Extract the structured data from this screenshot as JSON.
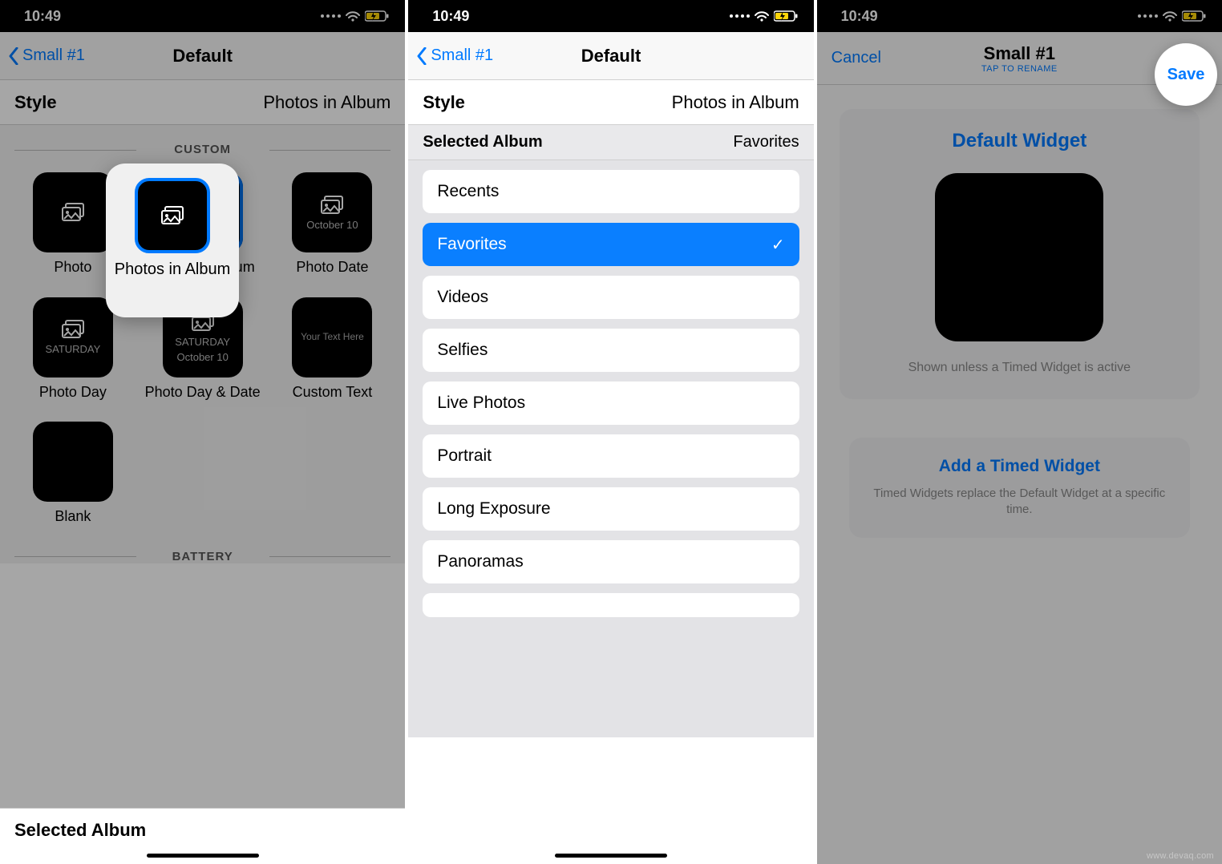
{
  "status": {
    "time": "10:49"
  },
  "colors": {
    "accent": "#007aff"
  },
  "phone1": {
    "back_label": "Small #1",
    "title": "Default",
    "style_label": "Style",
    "style_value": "Photos in Album",
    "section_custom": "CUSTOM",
    "section_battery": "BATTERY",
    "tiles": [
      {
        "key": "photo",
        "label": "Photo",
        "preview": "photos-icon"
      },
      {
        "key": "photos-in-album",
        "label": "Photos in Album",
        "preview": "photos-icon",
        "selected": true
      },
      {
        "key": "photo-date",
        "label": "Photo Date",
        "preview": "photos-icon",
        "preview_text": "October 10"
      },
      {
        "key": "photo-day",
        "label": "Photo Day",
        "preview": "photos-icon",
        "preview_text": "SATURDAY"
      },
      {
        "key": "photo-day-date",
        "label": "Photo Day & Date",
        "preview": "photos-icon",
        "preview_text": "SATURDAY",
        "preview_text2": "October 10"
      },
      {
        "key": "custom-text",
        "label": "Custom Text",
        "preview_text2_only": "Your Text Here"
      },
      {
        "key": "blank",
        "label": "Blank"
      }
    ],
    "sheet_label": "Selected Album"
  },
  "phone2": {
    "back_label": "Small #1",
    "title": "Default",
    "style_label": "Style",
    "style_value": "Photos in Album",
    "selected_album_label": "Selected Album",
    "selected_album_value": "Favorites",
    "albums": [
      {
        "name": "Recents",
        "selected": false
      },
      {
        "name": "Favorites",
        "selected": true
      },
      {
        "name": "Videos",
        "selected": false
      },
      {
        "name": "Selfies",
        "selected": false
      },
      {
        "name": "Live Photos",
        "selected": false
      },
      {
        "name": "Portrait",
        "selected": false
      },
      {
        "name": "Long Exposure",
        "selected": false
      },
      {
        "name": "Panoramas",
        "selected": false
      }
    ]
  },
  "phone3": {
    "cancel": "Cancel",
    "title": "Small #1",
    "subtitle": "TAP TO RENAME",
    "save": "Save",
    "widget_title": "Default Widget",
    "widget_note": "Shown unless a Timed Widget is active",
    "timed_title": "Add a Timed Widget",
    "timed_note": "Timed Widgets replace the Default Widget at a specific time."
  },
  "watermark": "www.devaq.com"
}
